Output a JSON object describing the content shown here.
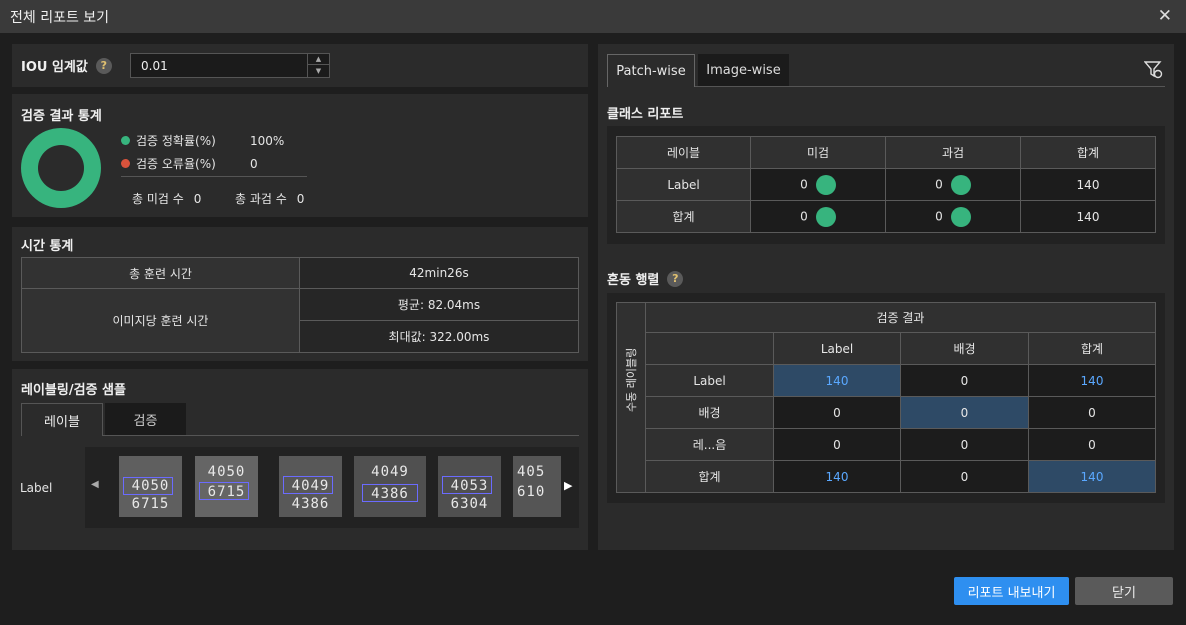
{
  "window": {
    "title": "전체 리포트 보기"
  },
  "iou": {
    "label": "IOU 임계값",
    "help": "?",
    "value": "0.01"
  },
  "stats": {
    "title": "검증 결과 통계",
    "accuracy_label": "검증 정확률(%)",
    "accuracy_value": "100%",
    "error_label": "검증 오류율(%)",
    "error_value": "0",
    "miss_label": "총 미검 수",
    "miss_value": "0",
    "over_label": "총 과검 수",
    "over_value": "0",
    "colors": {
      "accuracy": "#37b47e",
      "error": "#d9533c"
    }
  },
  "time": {
    "title": "시간 통계",
    "total_label": "총 훈련 시간",
    "total_value": "42min26s",
    "per_image_label": "이미지당 훈련 시간",
    "avg_value": "평균: 82.04ms",
    "max_value": "최대값: 322.00ms"
  },
  "samples": {
    "title": "레이블링/검증 샘플",
    "tabs": [
      "레이블",
      "검증"
    ],
    "row_label": "Label",
    "thumbs": [
      {
        "top": "4050",
        "bottom": "6715"
      },
      {
        "top": "4050",
        "bottom": "6715"
      },
      {
        "top": "4049",
        "bottom": "4386"
      },
      {
        "top": "4049",
        "bottom": "4386"
      },
      {
        "top": "4053",
        "bottom": "6304"
      },
      {
        "top": "405",
        "bottom": "610"
      }
    ]
  },
  "right": {
    "tabs": [
      "Patch-wise",
      "Image-wise"
    ],
    "class_report": {
      "title": "클래스 리포트",
      "headers": [
        "레이블",
        "미검",
        "과검",
        "합계"
      ],
      "rows": [
        {
          "label": "Label",
          "miss": "0",
          "over": "0",
          "total": "140"
        },
        {
          "label": "합계",
          "miss": "0",
          "over": "0",
          "total": "140"
        }
      ]
    },
    "confusion": {
      "title": "혼동 행렬",
      "help": "?",
      "result_header": "검증 결과",
      "side_label": "수동 레이블링",
      "col_headers": [
        "Label",
        "배경",
        "합계"
      ],
      "rows": [
        {
          "label": "Label",
          "values": [
            "140",
            "0",
            "140"
          ]
        },
        {
          "label": "배경",
          "values": [
            "0",
            "0",
            "0"
          ]
        },
        {
          "label": "레...음",
          "values": [
            "0",
            "0",
            "0"
          ]
        },
        {
          "label": "합계",
          "values": [
            "140",
            "0",
            "140"
          ]
        }
      ]
    }
  },
  "buttons": {
    "export": "리포트 내보내기",
    "close": "닫기"
  }
}
